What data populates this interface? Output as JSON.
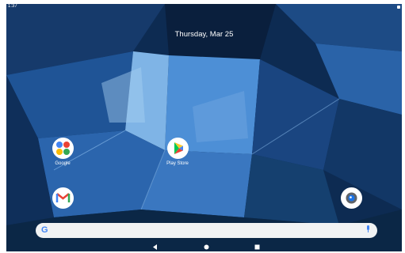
{
  "status_bar": {
    "time": "1:37"
  },
  "widget": {
    "date": "Thursday, Mar 25"
  },
  "apps": [
    {
      "label": "Google",
      "icon": "google-folder-icon"
    },
    {
      "label": "Play Store",
      "icon": "play-store-icon"
    },
    {
      "label": "",
      "icon": "gmail-icon"
    },
    {
      "label": "",
      "icon": "camera-icon"
    }
  ],
  "search": {
    "logo": "G",
    "icon": "mic-icon"
  },
  "nav": {
    "back": "back-icon",
    "home": "home-icon",
    "recents": "recents-icon"
  },
  "colors": {
    "google_blue": "#4285f4",
    "google_red": "#ea4335",
    "google_yellow": "#fbbc05",
    "google_green": "#34a853"
  }
}
